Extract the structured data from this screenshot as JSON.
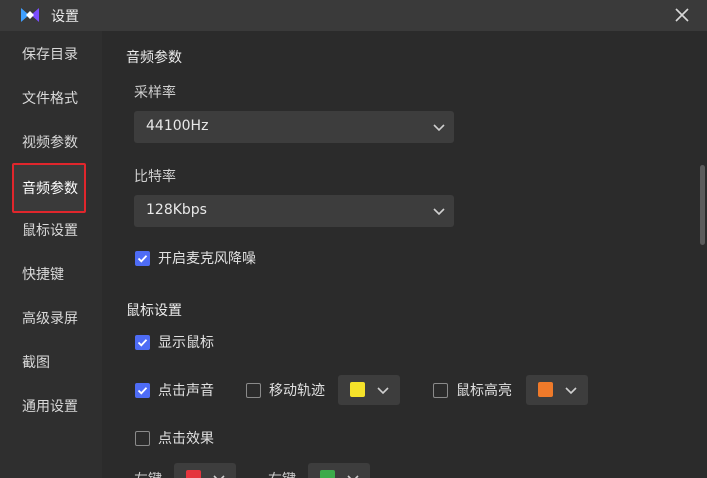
{
  "titlebar": {
    "title": "设置"
  },
  "sidebar": {
    "items": [
      {
        "label": "保存目录"
      },
      {
        "label": "文件格式"
      },
      {
        "label": "视频参数"
      },
      {
        "label": "音频参数"
      },
      {
        "label": "鼠标设置"
      },
      {
        "label": "快捷键"
      },
      {
        "label": "高级录屏"
      },
      {
        "label": "截图"
      },
      {
        "label": "通用设置"
      }
    ],
    "active": "音频参数"
  },
  "audio": {
    "section_title": "音频参数",
    "sample_rate_label": "采样率",
    "sample_rate_value": "44100Hz",
    "bitrate_label": "比特率",
    "bitrate_value": "128Kbps",
    "noise_reduction_label": "开启麦克风降噪",
    "noise_reduction_checked": true
  },
  "mouse": {
    "section_title": "鼠标设置",
    "show_cursor_label": "显示鼠标",
    "show_cursor_checked": true,
    "click_sound_label": "点击声音",
    "click_sound_checked": true,
    "move_track_label": "移动轨迹",
    "move_track_checked": false,
    "move_track_color": "#f5e22a",
    "highlight_label": "鼠标高亮",
    "highlight_checked": false,
    "highlight_color": "#ef7a2a",
    "click_effect_label": "点击效果",
    "click_effect_checked": false,
    "left_key_label": "左键",
    "left_key_color": "#e5343d",
    "right_key_label": "右键",
    "right_key_color": "#3cab4a"
  },
  "colors": {
    "accent": "#4e6cf5",
    "highlight_border": "#e0262c"
  }
}
